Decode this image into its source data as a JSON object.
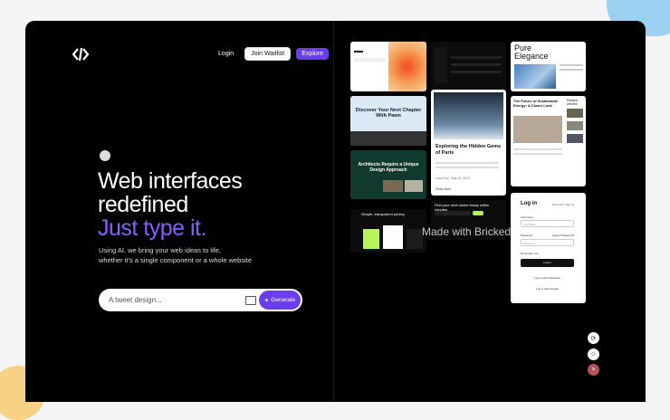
{
  "header": {
    "login_label": "Login",
    "waitlist_label": "Join Waitlist",
    "explore_label": "Explore"
  },
  "hero": {
    "line1": "Web interfaces",
    "line2": "redefined",
    "accent": "Just type it.",
    "sub1": "Using AI, we bring your web ideas to life,",
    "sub2": "whether it's a single component or a whole website"
  },
  "search": {
    "placeholder": "A tweet design...",
    "generate_label": "Generate"
  },
  "gallery": {
    "pure_title": "Pure",
    "pure_title2": "Elegance",
    "discover_title": "Discover Your Next Chapter With Pawn",
    "architects_title": "Architects Require a Unique Design Approach",
    "explore_title": "Exploring the Hidden Gems of Paris",
    "explore_author": "John Doe",
    "explore_date": "May 20, 2022",
    "read_more": "Read More",
    "future_title": "The Future of Sustainable Energy: A Closer Look",
    "related": "Related Articles",
    "career_title": "Find your next career today within minutes",
    "pricing_title": "Simple, transparent pricing",
    "login_title": "Log in",
    "login_new": "New User?",
    "login_signup": "Sign up",
    "email_label": "Username",
    "email_placeholder": "Username",
    "password_label": "Password",
    "forgot": "Forgot Password?",
    "password_placeholder": "Password",
    "remember": "Remember me",
    "login_button": "Log in",
    "facebook": "Log in with Facebook",
    "google": "Log in with Google"
  },
  "watermark": "Made with Bricked",
  "colors": {
    "accent": "#6a3cf0",
    "accent_text": "#8c5bff"
  }
}
